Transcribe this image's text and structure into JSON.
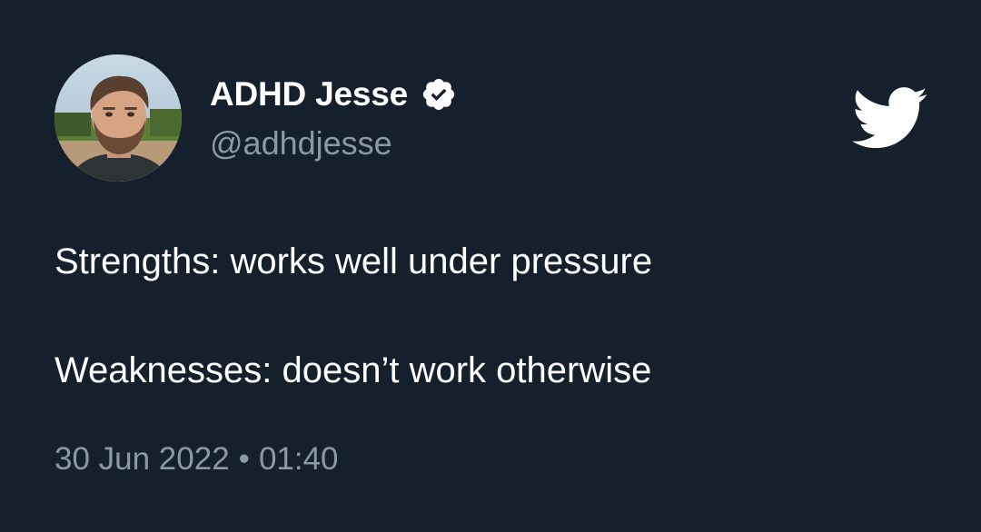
{
  "author": {
    "display_name": "ADHD Jesse",
    "handle": "@adhdjesse",
    "verified": true,
    "avatar_icon": "profile-photo"
  },
  "tweet": {
    "line1": "Strengths: works well under pressure",
    "line2": "Weaknesses: doesn’t work otherwise"
  },
  "meta": {
    "date": "30 Jun 2022",
    "separator": "•",
    "time": "01:40"
  },
  "branding": {
    "logo_icon": "twitter-bird-icon"
  },
  "colors": {
    "background": "#16202c",
    "primary_text": "#ffffff",
    "secondary_text": "#8b98a5"
  }
}
